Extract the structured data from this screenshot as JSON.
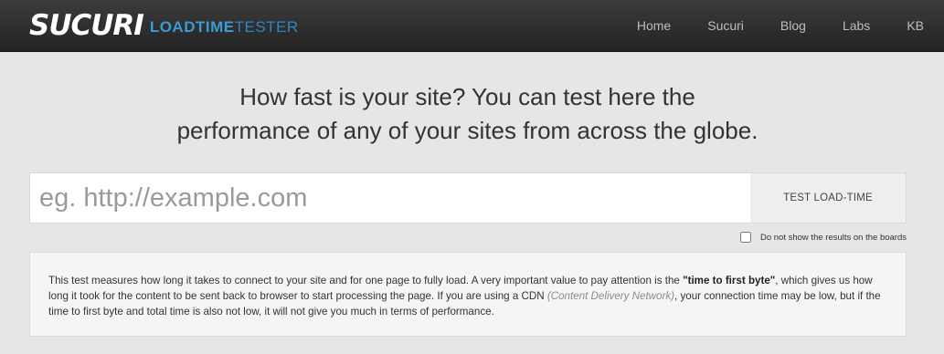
{
  "brand": {
    "logo": "SUCURI",
    "sub_bold": "LOADTIME",
    "sub_thin": "TESTER"
  },
  "nav": {
    "items": [
      "Home",
      "Sucuri",
      "Blog",
      "Labs",
      "KB"
    ]
  },
  "headline": {
    "line1": "How fast is your site? You can test here the",
    "line2": "performance of any of your sites from across the globe."
  },
  "search": {
    "placeholder": "eg. http://example.com",
    "value": "",
    "button_label": "TEST LOAD-TIME"
  },
  "options": {
    "hide_results_label": "Do not show the results on the boards",
    "hide_results_checked": false
  },
  "info": {
    "part1": "This test measures how long it takes to connect to your site and for one page to fully load. A very important value to pay attention is the ",
    "emphasis": "\"time to first byte\"",
    "part2": ", which gives us how long it took for the content to be sent back to browser to start processing the page. If you are using a CDN ",
    "cdn_note": "(Content Delivery Network)",
    "part3": ", your connection time may be low, but if the time to first byte and total time is also not low, it will not give you much in terms of performance."
  },
  "colors": {
    "navbar_bg": "#2d2d2d",
    "brand_accent": "#3a9bd5",
    "page_bg": "#e6e6e6"
  }
}
